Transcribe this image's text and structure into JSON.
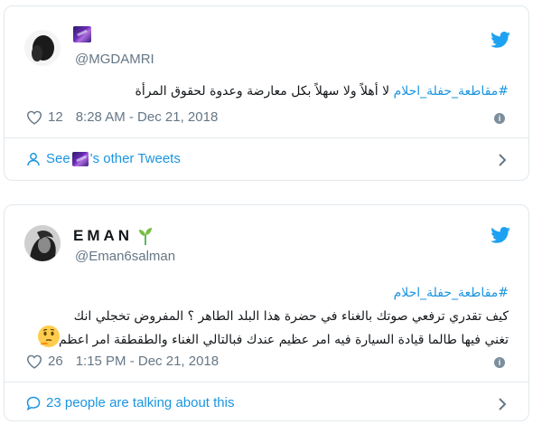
{
  "colors": {
    "link": "#1b95e0",
    "muted": "#657786",
    "border": "#e1e8ed",
    "twitter_blue": "#1da1f2"
  },
  "tweets": [
    {
      "display_name_icon": "galaxy-emoji",
      "handle": "@MGDAMRI",
      "text": {
        "hashtag": "#مقاطعة_حفلة_احلام",
        "body": "لا أهلاً ولا سهلاً بكل معارضة وعدوة لحقوق المرأة"
      },
      "likes": "12",
      "timestamp": "8:28 AM - Dec 21, 2018",
      "footer": {
        "prefix": "See",
        "suffix": "'s other Tweets"
      }
    },
    {
      "display_name": "EMAN",
      "display_name_icon": "sprout-emoji",
      "handle": "@Eman6salman",
      "text": {
        "hashtag": "#مقاطعة_حفلة_احلام",
        "line1": "كيف تقدري ترفعي صوتك بالغناء في حضرة هذا البلد الطاهر ؟ المفروض تخجلي انك",
        "line2": "تغني فيها طالما قيادة السيارة فيه امر عظيم عندك فبالتالي الغناء والطقطقة امر اعظم"
      },
      "emoji": "thinking-face-emoji",
      "likes": "26",
      "timestamp": "1:15 PM - Dec 21, 2018",
      "footer": {
        "label": "23 people are talking about this"
      }
    }
  ]
}
